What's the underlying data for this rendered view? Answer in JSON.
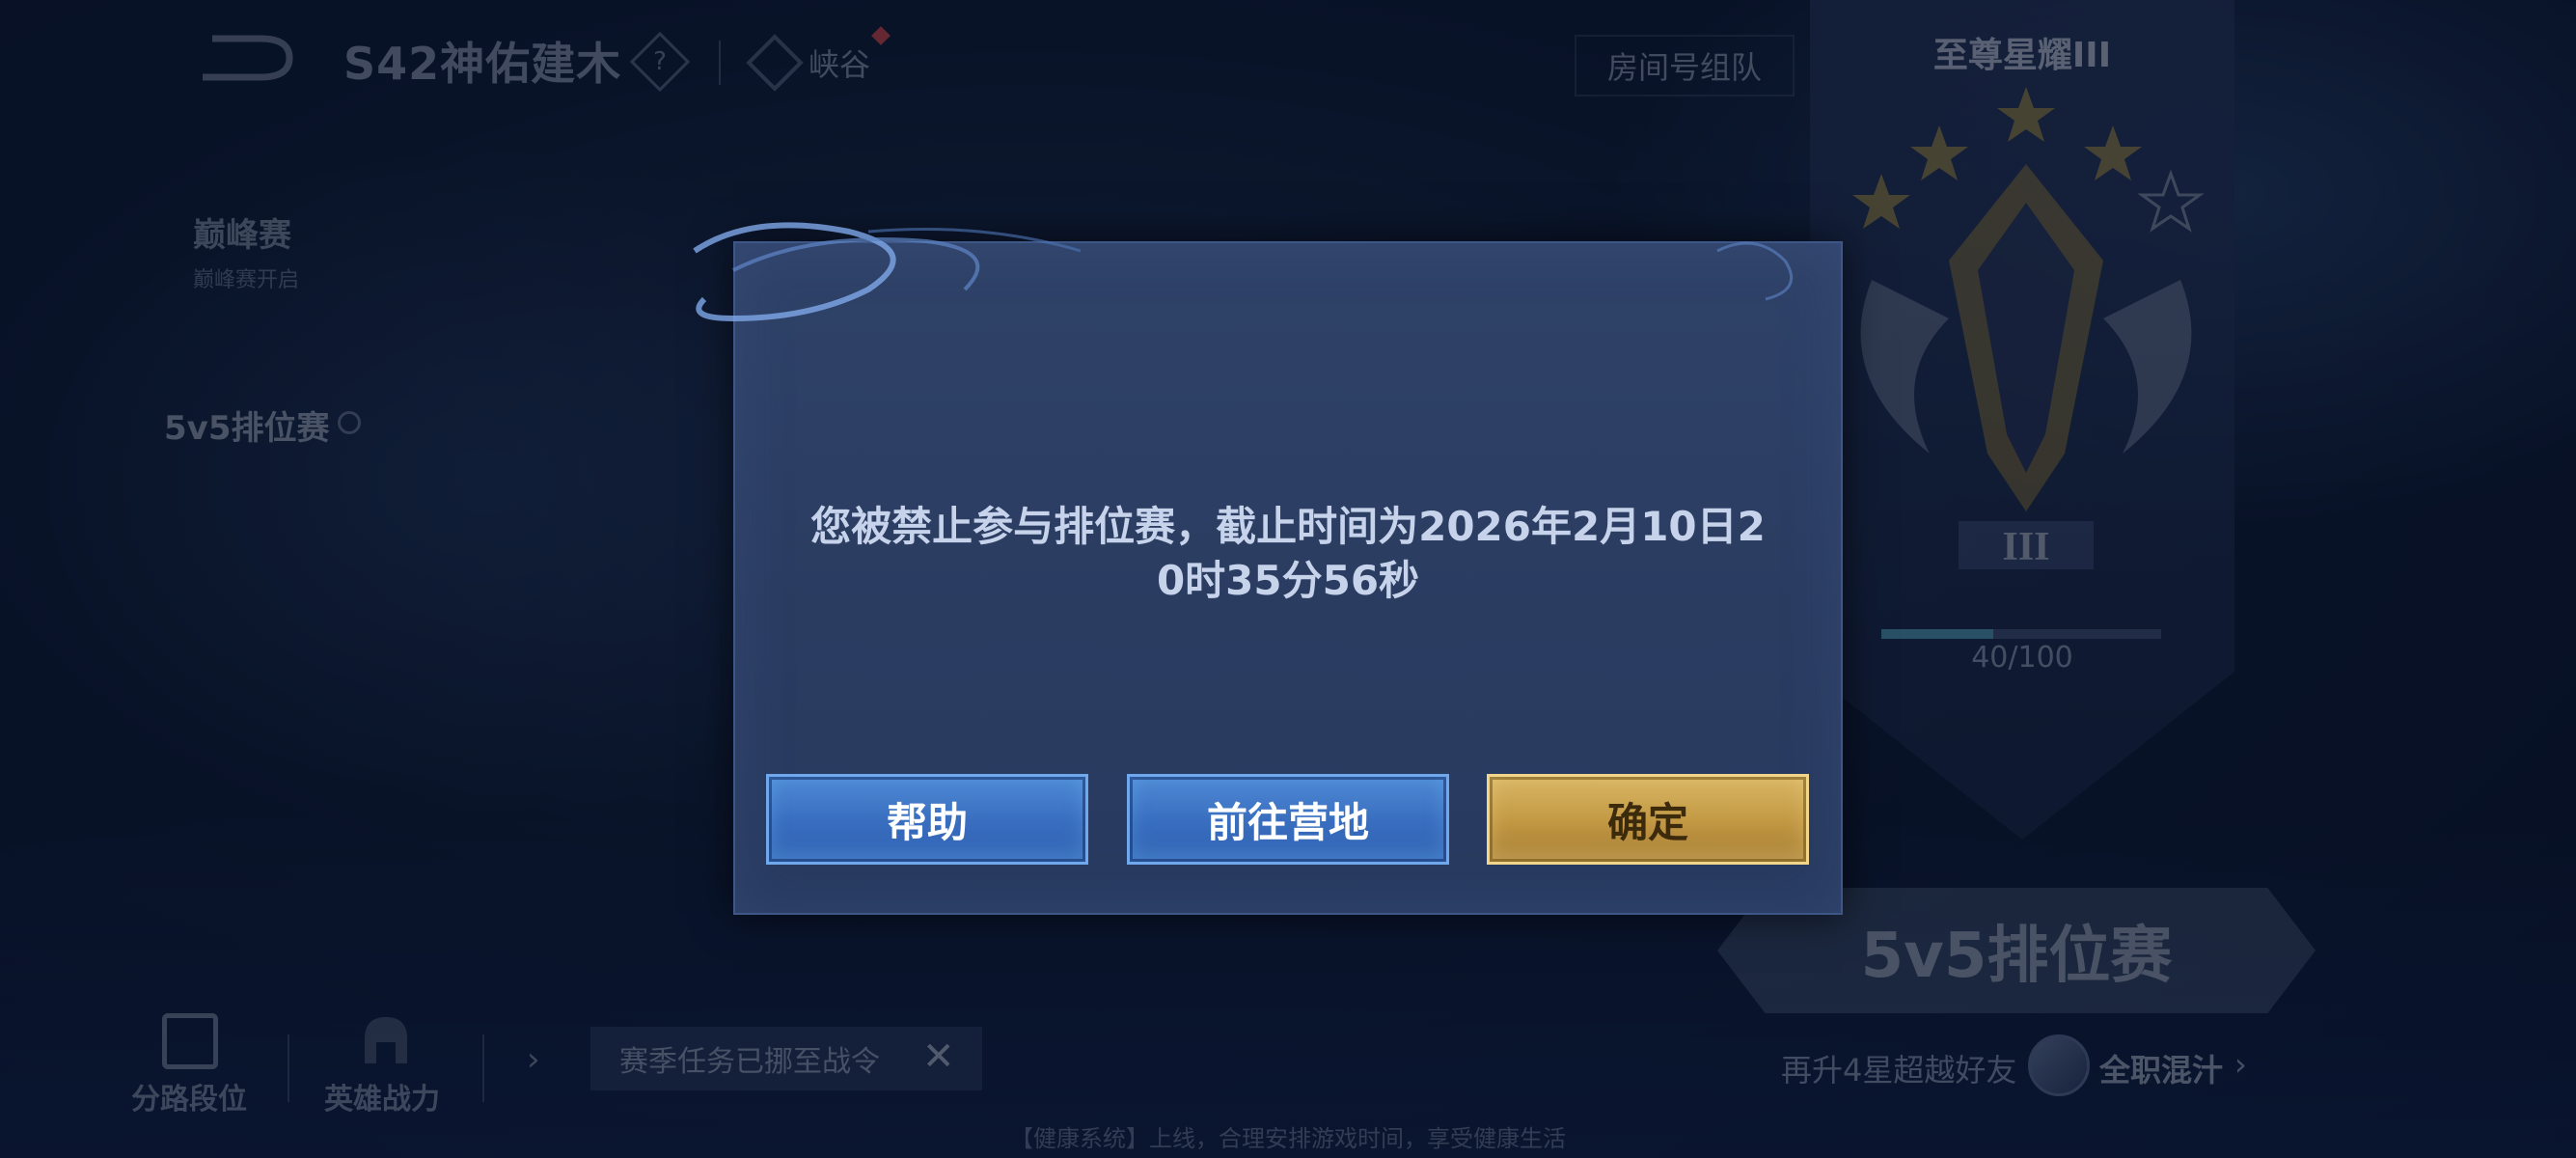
{
  "header": {
    "title": "S42神佑建木",
    "season_badge": "?",
    "map_label": "峡谷",
    "room_button": "房间号组队"
  },
  "modes": {
    "peak": {
      "label": "巅峰赛",
      "sub": "巅峰赛开启"
    },
    "ranked": {
      "label": "5v5排位赛"
    }
  },
  "rank": {
    "title": "至尊星耀III",
    "tier_numeral": "III",
    "progress_text": "40/100",
    "progress_value": 0.4
  },
  "start_button": "5v5排位赛",
  "promo": {
    "text": "再升4星超越好友",
    "friend_name": "全职混汁"
  },
  "bottom": {
    "lane_label": "分路段位",
    "hero_label": "英雄战力",
    "notice": "赛季任务已挪至战令",
    "health_tip": "【健康系统】上线，合理安排游戏时间，享受健康生活"
  },
  "dialog": {
    "message_line1": "您被禁止参与排位赛，截止时间为2026年2月10日2",
    "message_line2": "0时35分56秒",
    "buttons": {
      "help": "帮助",
      "camp": "前往营地",
      "ok": "确定"
    }
  },
  "colors": {
    "accent_blue": "#3a6fc0",
    "accent_gold": "#c49a45",
    "dialog_bg": "#2b3c61"
  }
}
